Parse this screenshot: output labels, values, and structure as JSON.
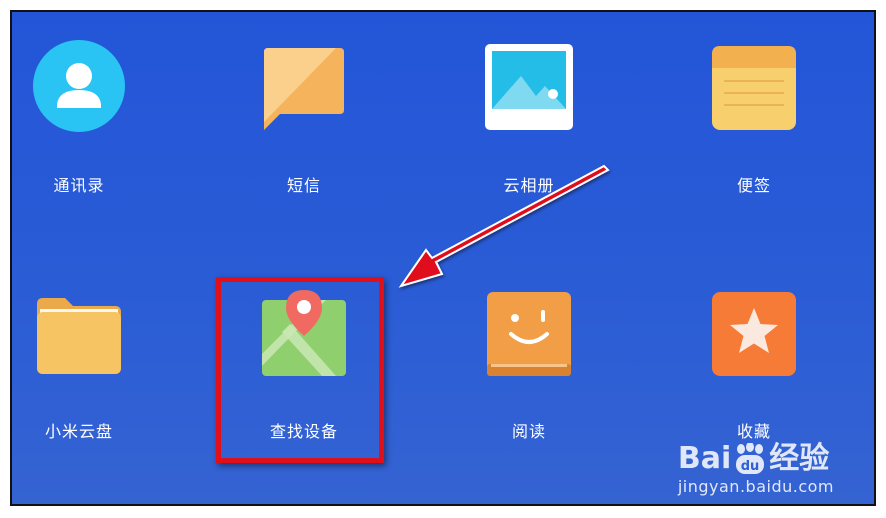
{
  "apps": [
    {
      "id": "contacts",
      "label": "通讯录",
      "icon": "contacts-icon"
    },
    {
      "id": "messages",
      "label": "短信",
      "icon": "message-icon"
    },
    {
      "id": "cloud-album",
      "label": "云相册",
      "icon": "photo-icon"
    },
    {
      "id": "notes",
      "label": "便签",
      "icon": "notepad-icon"
    },
    {
      "id": "cloud-drive",
      "label": "小米云盘",
      "icon": "folder-icon"
    },
    {
      "id": "find-device",
      "label": "查找设备",
      "icon": "map-pin-icon"
    },
    {
      "id": "reading",
      "label": "阅读",
      "icon": "book-icon"
    },
    {
      "id": "favorites",
      "label": "收藏",
      "icon": "star-icon"
    }
  ],
  "annotation": {
    "highlight_color": "#e0101a",
    "highlighted_app": "查找设备"
  },
  "watermark": {
    "brand_left": "Bai",
    "brand_right": "经验",
    "paw_text": "du",
    "url": "jingyan.baidu.com"
  },
  "colors": {
    "background": "#2757d6",
    "contacts": "#29c4f4",
    "messages": "#f5b35b",
    "notes": "#f7cf6d",
    "folder": "#f6c463",
    "map": "#8fcf6e",
    "book": "#f29e47",
    "favorites": "#f57b37"
  }
}
